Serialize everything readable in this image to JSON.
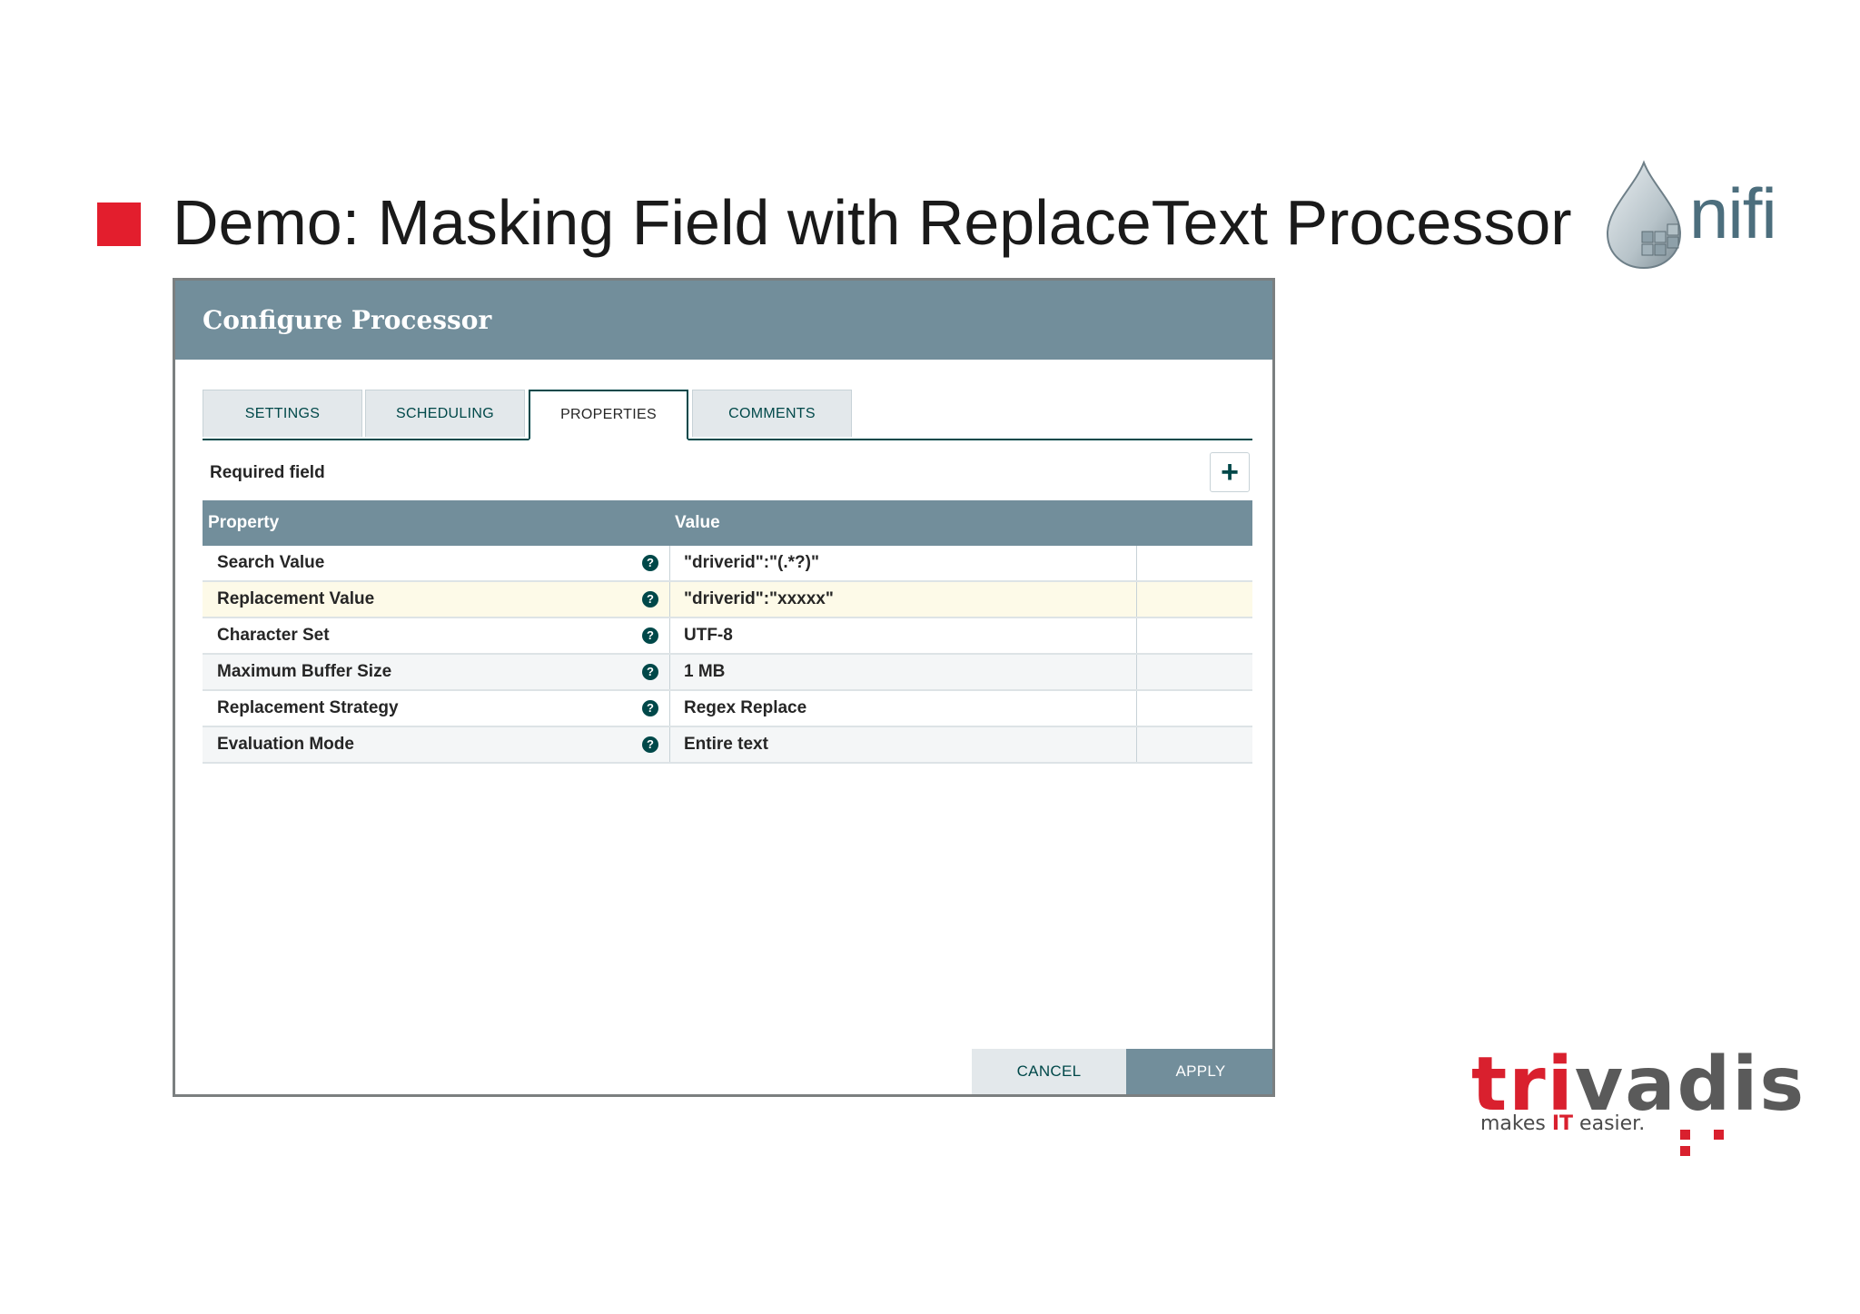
{
  "slide": {
    "title": "Demo: Masking Field with ReplaceText Processor",
    "nifi_logo_text": "nifi",
    "vendor_logo_text_red": "tri",
    "vendor_logo_text_grey": "vadis",
    "vendor_tagline_prefix": "makes ",
    "vendor_tagline_highlight": "IT",
    "vendor_tagline_suffix": " easier."
  },
  "dialog": {
    "title": "Configure Processor",
    "tabs": [
      {
        "label": "SETTINGS",
        "active": false
      },
      {
        "label": "SCHEDULING",
        "active": false
      },
      {
        "label": "PROPERTIES",
        "active": true
      },
      {
        "label": "COMMENTS",
        "active": false
      }
    ],
    "required_label": "Required field",
    "add_button_icon": "plus-icon",
    "table": {
      "headers": {
        "property": "Property",
        "value": "Value"
      },
      "rows": [
        {
          "property": "Search Value",
          "value": "\"driverid\":\"(.*?)\""
        },
        {
          "property": "Replacement Value",
          "value": "\"driverid\":\"xxxxx\""
        },
        {
          "property": "Character Set",
          "value": "UTF-8"
        },
        {
          "property": "Maximum Buffer Size",
          "value": "1 MB"
        },
        {
          "property": "Replacement Strategy",
          "value": "Regex Replace"
        },
        {
          "property": "Evaluation Mode",
          "value": "Entire text"
        }
      ]
    },
    "buttons": {
      "cancel": "CANCEL",
      "apply": "APPLY"
    }
  },
  "colors": {
    "accent_red": "#e31e2d",
    "header_bg": "#728e9b",
    "nifi_teal": "#004849",
    "selected_row": "#fdfae8"
  }
}
